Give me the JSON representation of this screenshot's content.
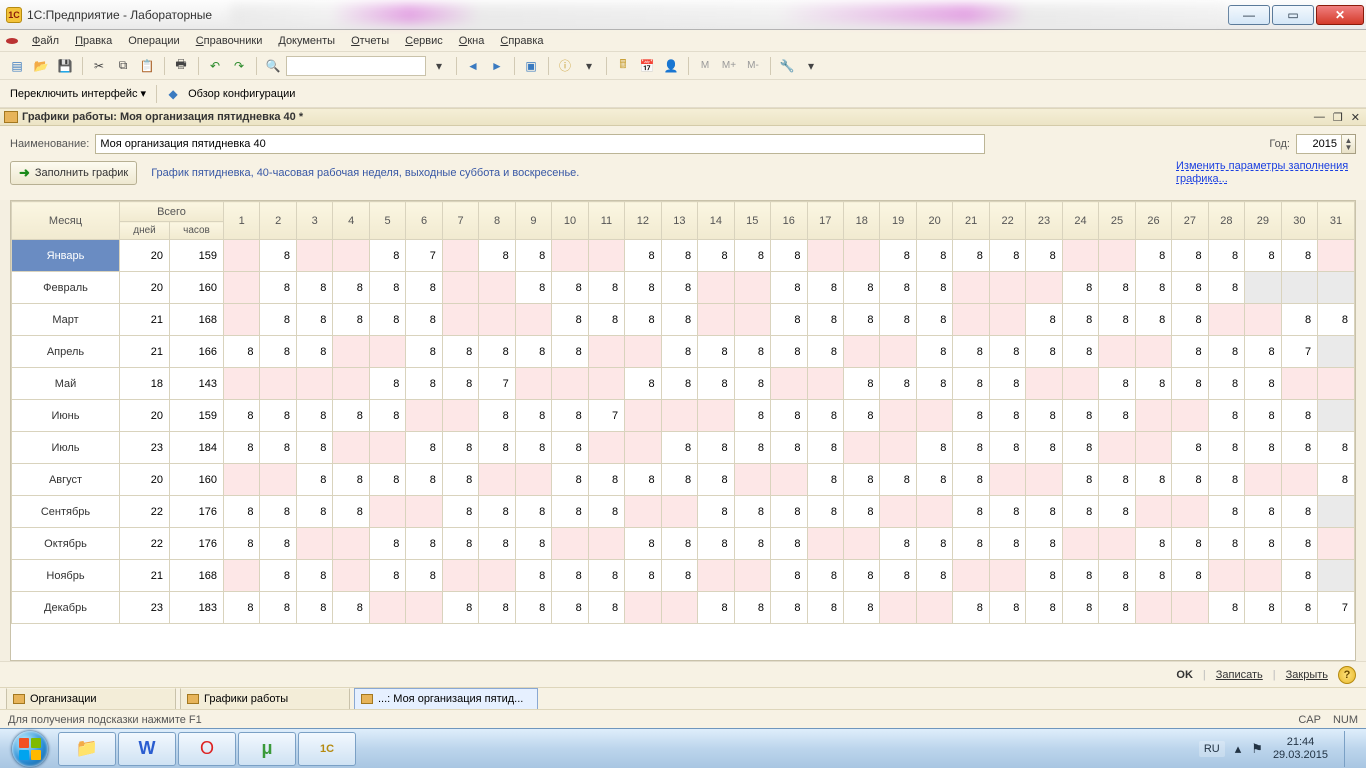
{
  "window": {
    "title": "1С:Предприятие - Лабораторные"
  },
  "menu": [
    "Файл",
    "Правка",
    "Операции",
    "Справочники",
    "Документы",
    "Отчеты",
    "Сервис",
    "Окна",
    "Справка"
  ],
  "menu_keys": [
    0,
    0,
    null,
    0,
    0,
    0,
    0,
    0,
    0
  ],
  "tb2": {
    "switch": "Переключить интерфейс ▾",
    "review": "Обзор конфигурации"
  },
  "mdi": {
    "title": "Графики работы: Моя организация пятидневка 40 *"
  },
  "form": {
    "name_label": "Наименование:",
    "name_value": "Моя организация пятидневка 40",
    "year_label": "Год:",
    "year_value": "2015",
    "fill_btn": "Заполнить график",
    "description": "График пятидневка, 40-часовая рабочая неделя, выходные суббота и воскресенье.",
    "change_link": "Изменить параметры заполнения графика..."
  },
  "cal": {
    "h_month": "Месяц",
    "h_total": "Всего",
    "h_days": "дней",
    "h_hours": "часов",
    "months": [
      {
        "name": "Январь",
        "days": 20,
        "hours": 159,
        "cells": [
          "w",
          "8",
          "w",
          "w",
          "8",
          "7",
          "w",
          "8",
          "8",
          "w",
          "w",
          "8",
          "8",
          "8",
          "8",
          "8",
          "w",
          "w",
          "8",
          "8",
          "8",
          "8",
          "8",
          "w",
          "w",
          "8",
          "8",
          "8",
          "8",
          "8",
          "w"
        ]
      },
      {
        "name": "Февраль",
        "days": 20,
        "hours": 160,
        "cells": [
          "w",
          "8",
          "8",
          "8",
          "8",
          "8",
          "w",
          "w",
          "8",
          "8",
          "8",
          "8",
          "8",
          "w",
          "w",
          "8",
          "8",
          "8",
          "8",
          "8",
          "w",
          "w",
          "w",
          "8",
          "8",
          "8",
          "8",
          "8",
          "g",
          "g",
          "g"
        ]
      },
      {
        "name": "Март",
        "days": 21,
        "hours": 168,
        "cells": [
          "w",
          "8",
          "8",
          "8",
          "8",
          "8",
          "w",
          "w",
          "w",
          "8",
          "8",
          "8",
          "8",
          "w",
          "w",
          "8",
          "8",
          "8",
          "8",
          "8",
          "w",
          "w",
          "8",
          "8",
          "8",
          "8",
          "8",
          "w",
          "w",
          "8",
          "8"
        ]
      },
      {
        "name": "Апрель",
        "days": 21,
        "hours": 166,
        "cells": [
          "8",
          "8",
          "8",
          "w",
          "w",
          "8",
          "8",
          "8",
          "8",
          "8",
          "w",
          "w",
          "8",
          "8",
          "8",
          "8",
          "8",
          "w",
          "w",
          "8",
          "8",
          "8",
          "8",
          "8",
          "w",
          "w",
          "8",
          "8",
          "8",
          "7",
          "g"
        ]
      },
      {
        "name": "Май",
        "days": 18,
        "hours": 143,
        "cells": [
          "w",
          "w",
          "w",
          "w",
          "8",
          "8",
          "8",
          "7",
          "w",
          "w",
          "w",
          "8",
          "8",
          "8",
          "8",
          "w",
          "w",
          "8",
          "8",
          "8",
          "8",
          "8",
          "w",
          "w",
          "8",
          "8",
          "8",
          "8",
          "8",
          "w",
          "w"
        ]
      },
      {
        "name": "Июнь",
        "days": 20,
        "hours": 159,
        "cells": [
          "8",
          "8",
          "8",
          "8",
          "8",
          "w",
          "w",
          "8",
          "8",
          "8",
          "7",
          "w",
          "w",
          "w",
          "8",
          "8",
          "8",
          "8",
          "w",
          "w",
          "8",
          "8",
          "8",
          "8",
          "8",
          "w",
          "w",
          "8",
          "8",
          "8",
          "g"
        ]
      },
      {
        "name": "Июль",
        "days": 23,
        "hours": 184,
        "cells": [
          "8",
          "8",
          "8",
          "w",
          "w",
          "8",
          "8",
          "8",
          "8",
          "8",
          "w",
          "w",
          "8",
          "8",
          "8",
          "8",
          "8",
          "w",
          "w",
          "8",
          "8",
          "8",
          "8",
          "8",
          "w",
          "w",
          "8",
          "8",
          "8",
          "8",
          "8"
        ]
      },
      {
        "name": "Август",
        "days": 20,
        "hours": 160,
        "cells": [
          "w",
          "w",
          "8",
          "8",
          "8",
          "8",
          "8",
          "w",
          "w",
          "8",
          "8",
          "8",
          "8",
          "8",
          "w",
          "w",
          "8",
          "8",
          "8",
          "8",
          "8",
          "w",
          "w",
          "8",
          "8",
          "8",
          "8",
          "8",
          "w",
          "w",
          "8"
        ]
      },
      {
        "name": "Сентябрь",
        "days": 22,
        "hours": 176,
        "cells": [
          "8",
          "8",
          "8",
          "8",
          "w",
          "w",
          "8",
          "8",
          "8",
          "8",
          "8",
          "w",
          "w",
          "8",
          "8",
          "8",
          "8",
          "8",
          "w",
          "w",
          "8",
          "8",
          "8",
          "8",
          "8",
          "w",
          "w",
          "8",
          "8",
          "8",
          "g"
        ]
      },
      {
        "name": "Октябрь",
        "days": 22,
        "hours": 176,
        "cells": [
          "8",
          "8",
          "w",
          "w",
          "8",
          "8",
          "8",
          "8",
          "8",
          "w",
          "w",
          "8",
          "8",
          "8",
          "8",
          "8",
          "w",
          "w",
          "8",
          "8",
          "8",
          "8",
          "8",
          "w",
          "w",
          "8",
          "8",
          "8",
          "8",
          "8",
          "w"
        ]
      },
      {
        "name": "Ноябрь",
        "days": 21,
        "hours": 168,
        "cells": [
          "w",
          "8",
          "8",
          "w",
          "8",
          "8",
          "w",
          "w",
          "8",
          "8",
          "8",
          "8",
          "8",
          "w",
          "w",
          "8",
          "8",
          "8",
          "8",
          "8",
          "w",
          "w",
          "8",
          "8",
          "8",
          "8",
          "8",
          "w",
          "w",
          "8",
          "g"
        ]
      },
      {
        "name": "Декабрь",
        "days": 23,
        "hours": 183,
        "cells": [
          "8",
          "8",
          "8",
          "8",
          "w",
          "w",
          "8",
          "8",
          "8",
          "8",
          "8",
          "w",
          "w",
          "8",
          "8",
          "8",
          "8",
          "8",
          "w",
          "w",
          "8",
          "8",
          "8",
          "8",
          "8",
          "w",
          "w",
          "8",
          "8",
          "8",
          "7"
        ]
      }
    ]
  },
  "actions": {
    "ok": "OK",
    "save": "Записать",
    "close": "Закрыть"
  },
  "footer_tabs": [
    "Организации",
    "Графики работы",
    "...: Моя организация пятид..."
  ],
  "status": {
    "hint": "Для получения подсказки нажмите F1",
    "cap": "CAP",
    "num": "NUM"
  },
  "tray": {
    "lang": "RU",
    "time": "21:44",
    "date": "29.03.2015"
  }
}
